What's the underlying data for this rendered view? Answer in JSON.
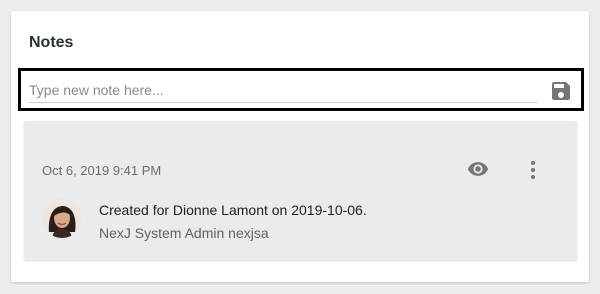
{
  "notes_panel": {
    "title": "Notes",
    "new_note": {
      "value": "",
      "placeholder": "Type new note here...",
      "save_icon": "save-icon"
    },
    "items": [
      {
        "timestamp": "Oct 6, 2019 9:41 PM",
        "text": "Created for Dionne Lamont on 2019-10-06.",
        "author": "NexJ System Admin nexjsa",
        "view_icon": "eye-icon",
        "menu_icon": "more-vertical-icon"
      }
    ]
  },
  "colors": {
    "icon": "#757575",
    "note_background": "#e9ecef",
    "focus_border": "#000000"
  }
}
